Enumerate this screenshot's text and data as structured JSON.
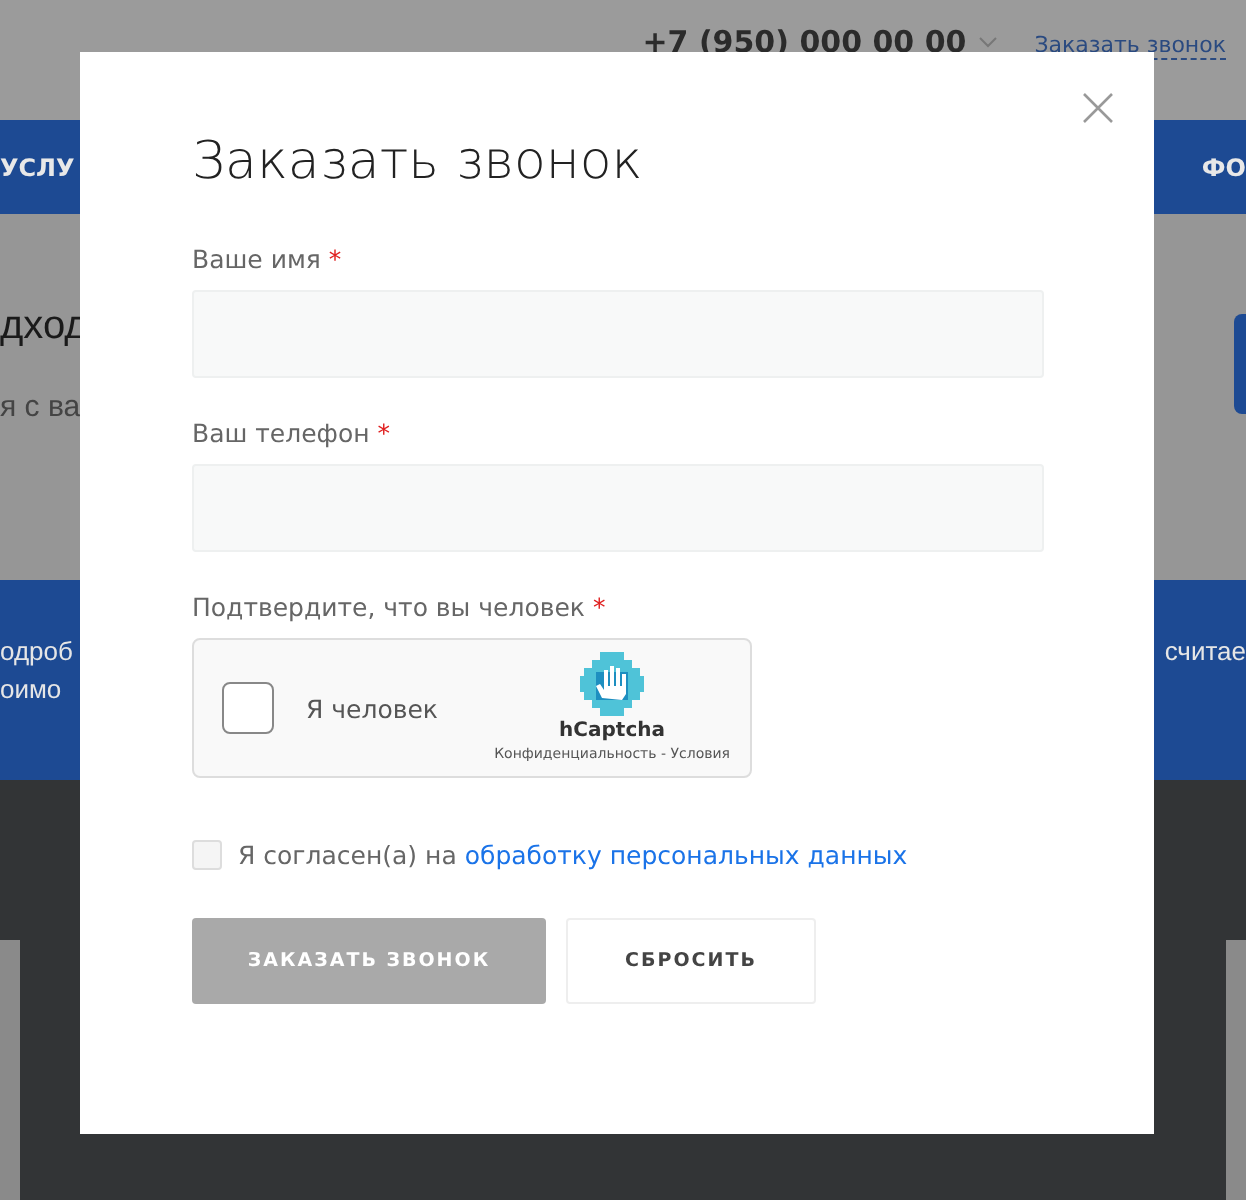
{
  "header": {
    "phone": "+7 (950) 000 00 00",
    "callback_link": "Заказать звонок"
  },
  "nav": {
    "left_item": "УСЛУ",
    "right_item": "ФО"
  },
  "hero": {
    "heading": "дход",
    "subheading": "я с ва"
  },
  "band": {
    "left_lines": [
      "одроб",
      "оимо"
    ],
    "right_line": "считае"
  },
  "modal": {
    "title": "Заказать звонок",
    "fields": [
      {
        "label": "Ваше имя",
        "required_mark": "*"
      },
      {
        "label": "Ваш телефон",
        "required_mark": "*"
      }
    ],
    "captcha": {
      "label": "Подтвердите, что вы человек",
      "required_mark": "*",
      "checkbox_label": "Я человек",
      "checked": false,
      "brand": "hCaptcha",
      "links": "Конфиденциальность - Условия"
    },
    "consent": {
      "checked": false,
      "text": "Я согласен(а) на",
      "link": "обработку персональных данных"
    },
    "buttons": [
      {
        "label": "ЗАКАЗАТЬ ЗВОНОК",
        "kind": "primary",
        "disabled": true
      },
      {
        "label": "СБРОСИТЬ",
        "kind": "secondary",
        "disabled": false
      }
    ]
  }
}
